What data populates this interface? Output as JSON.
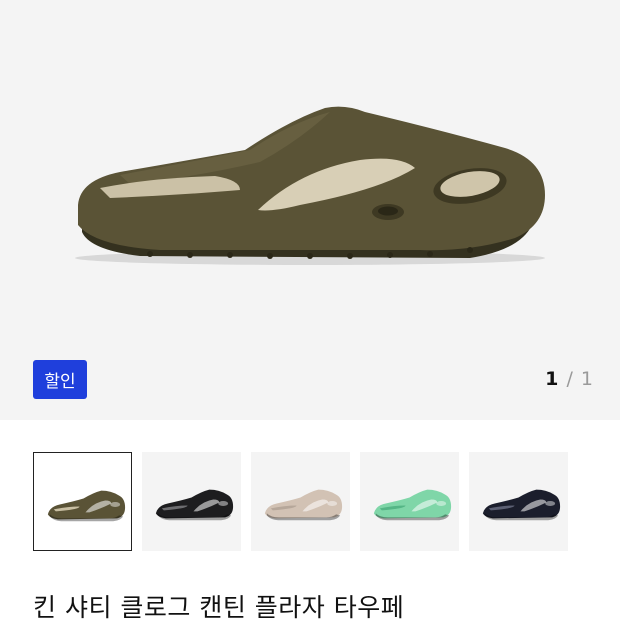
{
  "badge": {
    "label": "할인"
  },
  "pager": {
    "current": "1",
    "separator": "/",
    "total": "1"
  },
  "thumbnails": [
    {
      "color": "#5a5336",
      "insole": "#c9bfa3"
    },
    {
      "color": "#1d1d1f",
      "insole": "#6d6d70"
    },
    {
      "color": "#d2c2b4",
      "insole": "#b6a79a"
    },
    {
      "color": "#7fd6a8",
      "insole": "#55b686"
    },
    {
      "color": "#1b1e2c",
      "insole": "#5c6073"
    }
  ],
  "product": {
    "title": "킨 샤티 클로그 캔틴 플라자 타우페"
  },
  "colors": {
    "shoe": "#564f33",
    "sole": "#4a442b",
    "insole": "#cbc1a6",
    "badge": "#1f3fdc"
  }
}
